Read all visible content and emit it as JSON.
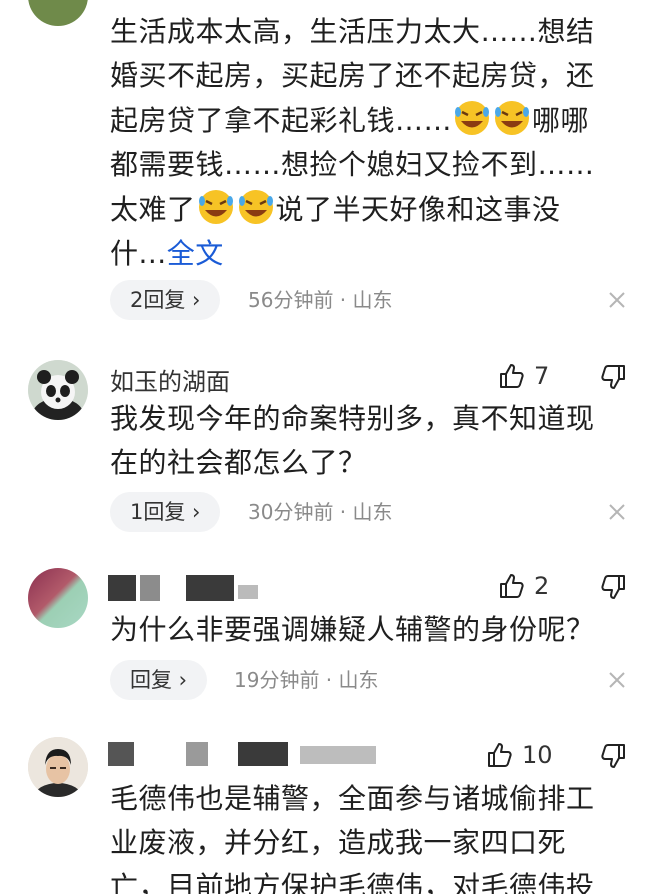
{
  "comments": [
    {
      "lines": [
        "生活成本太高，生活压力太大……想结",
        "婚买不起房，买起房了还不起房贷，还",
        "起房贷了拿不起彩礼钱……",
        "都需要钱……想捡个媳妇又捡不到……",
        "太难了",
        "什..."
      ],
      "inline_1": "哪哪",
      "inline_2": "说了半天好像和这事没",
      "more_label": "全文",
      "reply_label": "2回复 ›",
      "meta": "56分钟前 · 山东",
      "emoji_icon": "rolling-laughing-emoji"
    },
    {
      "username": "如玉的湖面",
      "likes": "7",
      "lines": [
        "我发现今年的命案特别多，真不知道现",
        "在的社会都怎么了？"
      ],
      "reply_label": "1回复 ›",
      "meta": "30分钟前 · 山东"
    },
    {
      "likes": "2",
      "lines": [
        "为什么非要强调嫌疑人辅警的身份呢？"
      ],
      "reply_label": "回复 ›",
      "meta": "19分钟前 · 山东"
    },
    {
      "likes": "10",
      "lines": [
        "毛德伟也是辅警，全面参与诸城偷排工",
        "业废液，并分红，造成我一家四口死",
        "亡，目前地方保护毛德伟，对毛德伟投"
      ]
    }
  ],
  "icons": {
    "like": "thumbs-up-icon",
    "dislike": "thumbs-down-icon",
    "close": "close-icon"
  },
  "colors": {
    "link": "#1a5bd6",
    "meta": "#8a8a8a",
    "pill": "#f2f3f5"
  }
}
